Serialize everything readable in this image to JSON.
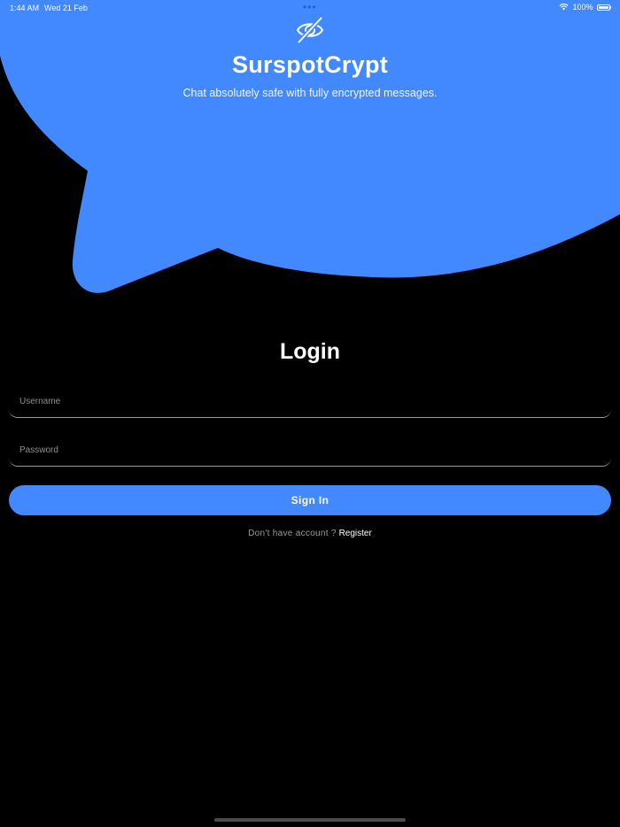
{
  "status_bar": {
    "time": "1:44 AM",
    "date": "Wed 21 Feb",
    "multitask_dots": "•••",
    "battery_text": "100%"
  },
  "header": {
    "logo_icon": "eye-off-icon",
    "app_title": "SurspotCrypt",
    "subtitle": "Chat absolutely safe with fully encrypted messages."
  },
  "login": {
    "heading": "Login",
    "username": {
      "placeholder": "Username",
      "value": ""
    },
    "password": {
      "placeholder": "Password",
      "value": ""
    },
    "sign_in_label": "Sign In",
    "register_prompt": "Don't have account ?",
    "register_link": "Register"
  },
  "colors": {
    "accent": "#4289ff",
    "background": "#000000"
  }
}
